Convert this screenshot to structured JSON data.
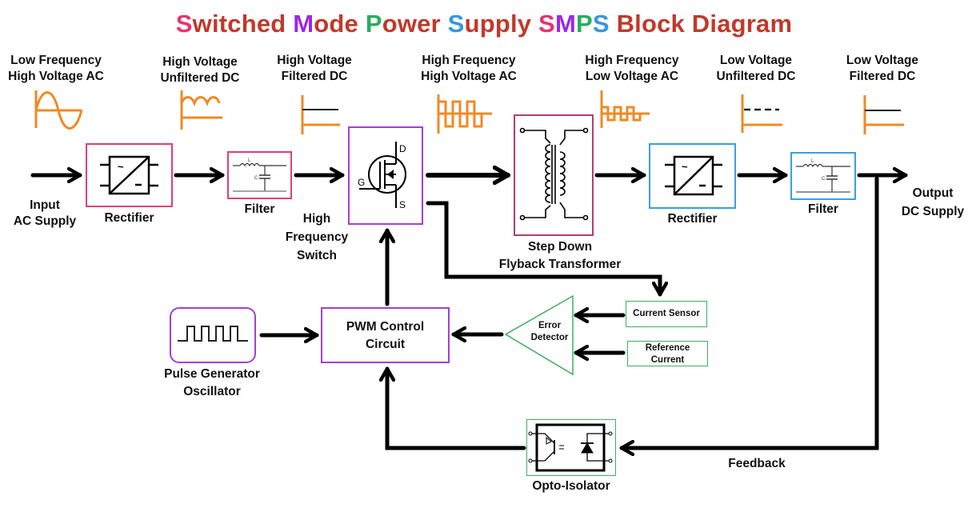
{
  "title": {
    "segments": [
      {
        "text": "S",
        "color": "#e8336d"
      },
      {
        "text": "witched ",
        "color": "#c0392b"
      },
      {
        "text": "M",
        "color": "#9b27e8"
      },
      {
        "text": "ode ",
        "color": "#c0392b"
      },
      {
        "text": "P",
        "color": "#27ae60"
      },
      {
        "text": "ower ",
        "color": "#c0392b"
      },
      {
        "text": "S",
        "color": "#3498db"
      },
      {
        "text": "upply ",
        "color": "#c0392b"
      },
      {
        "text": "S",
        "color": "#e8336d"
      },
      {
        "text": "M",
        "color": "#9b27e8"
      },
      {
        "text": "P",
        "color": "#27ae60"
      },
      {
        "text": "S",
        "color": "#3498db"
      },
      {
        "text": " Block Diagram",
        "color": "#c0392b"
      }
    ]
  },
  "waveforms": [
    {
      "line1": "Low Frequency",
      "line2": "High Voltage AC",
      "icon": "sine-wave-icon"
    },
    {
      "line1": "High Voltage",
      "line2": "Unfiltered DC",
      "icon": "rectified-wave-icon"
    },
    {
      "line1": "High Voltage",
      "line2": "Filtered DC",
      "icon": "filtered-dc-icon"
    },
    {
      "line1": "High Frequency",
      "line2": "High Voltage AC",
      "icon": "square-wave-icon"
    },
    {
      "line1": "High Frequency",
      "line2": "Low Voltage AC",
      "icon": "small-square-wave-icon"
    },
    {
      "line1": "Low Voltage",
      "line2": "Unfiltered DC",
      "icon": "dashed-dc-icon"
    },
    {
      "line1": "Low Voltage",
      "line2": "Filtered DC",
      "icon": "filtered-dc-icon"
    }
  ],
  "blocks": {
    "input": {
      "line1": "Input",
      "line2": "AC Supply"
    },
    "rectifier1": {
      "label": "Rectifier"
    },
    "filter1": {
      "label": "Filter",
      "inductor": "L",
      "capacitor": "C"
    },
    "switch": {
      "line1": "High",
      "line2": "Frequency",
      "line3": "Switch",
      "drain": "D",
      "gate": "G",
      "source": "S"
    },
    "transformer": {
      "line1": "Step Down",
      "line2": "Flyback Transformer"
    },
    "rectifier2": {
      "label": "Rectifier"
    },
    "filter2": {
      "label": "Filter",
      "inductor": "L",
      "capacitor": "C"
    },
    "output": {
      "line1": "Output",
      "line2": "DC Supply"
    },
    "pulse_generator": {
      "line1": "Pulse Generator",
      "line2": "Oscillator"
    },
    "pwm": {
      "line1": "PWM Control",
      "line2": "Circuit"
    },
    "error_detector": {
      "line1": "Error",
      "line2": "Detector"
    },
    "current_sensor": {
      "label": "Current Sensor"
    },
    "reference_current": {
      "line1": "Reference",
      "line2": "Current"
    },
    "opto_isolator": {
      "label": "Opto-Isolator"
    },
    "feedback": {
      "label": "Feedback"
    }
  },
  "colors": {
    "pink_box": "#e0407a",
    "purple_box": "#a040d8",
    "maroon_box": "#b04070",
    "blue_box": "#3aa0e0",
    "green_box": "#3cb060",
    "waveform": "#f08a24",
    "line": "#000000"
  }
}
